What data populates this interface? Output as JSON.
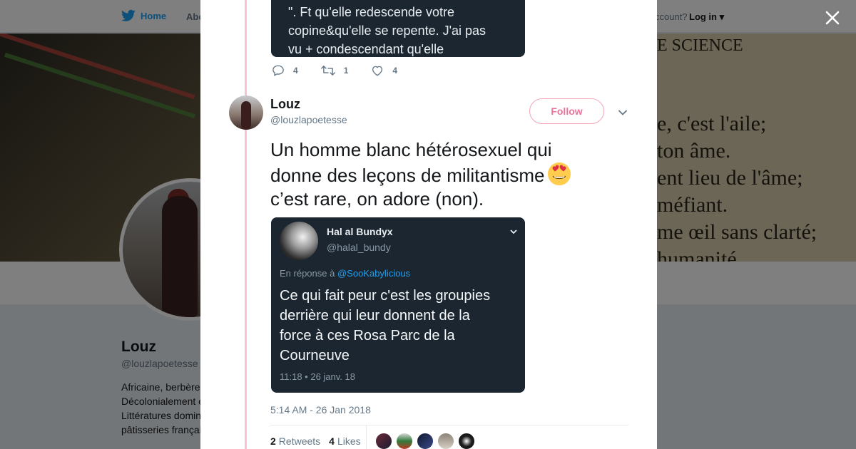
{
  "nav": {
    "home_label": "Home",
    "about_label": "Abo",
    "account_prompt": "ccount?",
    "login_label": "Log in"
  },
  "background_profile": {
    "name": "Louz",
    "handle": "@louzlapoetesse",
    "bio_lines": [
      "Africaine, berbère",
      "Décolonialement e",
      "Littératures domin",
      "pâtisseries françai"
    ],
    "banner_text_lines": [
      "E SCIENCE",
      "e, c'est l'aile;",
      "ton âme.",
      "ent lieu de l'âme;",
      "méfiant.",
      "me œil sans clarté;",
      "humanité"
    ]
  },
  "previous_tweet": {
    "image_text_lines": [
      "\". Ft qu'elle redescende votre",
      "copine&qu'elle se repente. J'ai pas",
      "vu + condescendant qu'elle"
    ],
    "replies": "4",
    "retweets": "1",
    "likes": "4"
  },
  "tweet": {
    "author_name": "Louz",
    "author_handle": "@louzlapoetesse",
    "follow_label": "Follow",
    "text_lines": [
      "Un homme blanc hétérosexuel qui",
      "donne des leçons de militantisme",
      "c’est rare, on adore (non)."
    ],
    "emoji": "heart-eyes-emoji",
    "timestamp": "5:14 AM - 26 Jan 2018",
    "retweet_count": "2",
    "retweets_label": "Retweets",
    "like_count": "4",
    "likes_label": "Likes"
  },
  "quoted_image": {
    "name": "Hal al Bundyx",
    "handle": "@halal_bundy",
    "reply_prefix": "En réponse à",
    "reply_mention": "@SooKabylicious",
    "body_lines": [
      "Ce qui fait peur c'est les groupies",
      "derrière qui leur donnent de la",
      "force à ces Rosa Parc de la",
      "Courneuve"
    ],
    "time": "11:18 • 26 janv. 18"
  },
  "icons": {
    "close": "close-icon",
    "reply": "reply-icon",
    "retweet": "retweet-icon",
    "like": "heart-icon",
    "caret": "chevron-down-icon",
    "brand": "twitter-bird-icon"
  },
  "colors": {
    "brand_blue": "#1da1f2",
    "follow_pink": "#e8739a",
    "thread_line": "#f8c3cf",
    "card_dark": "#1c2630"
  }
}
